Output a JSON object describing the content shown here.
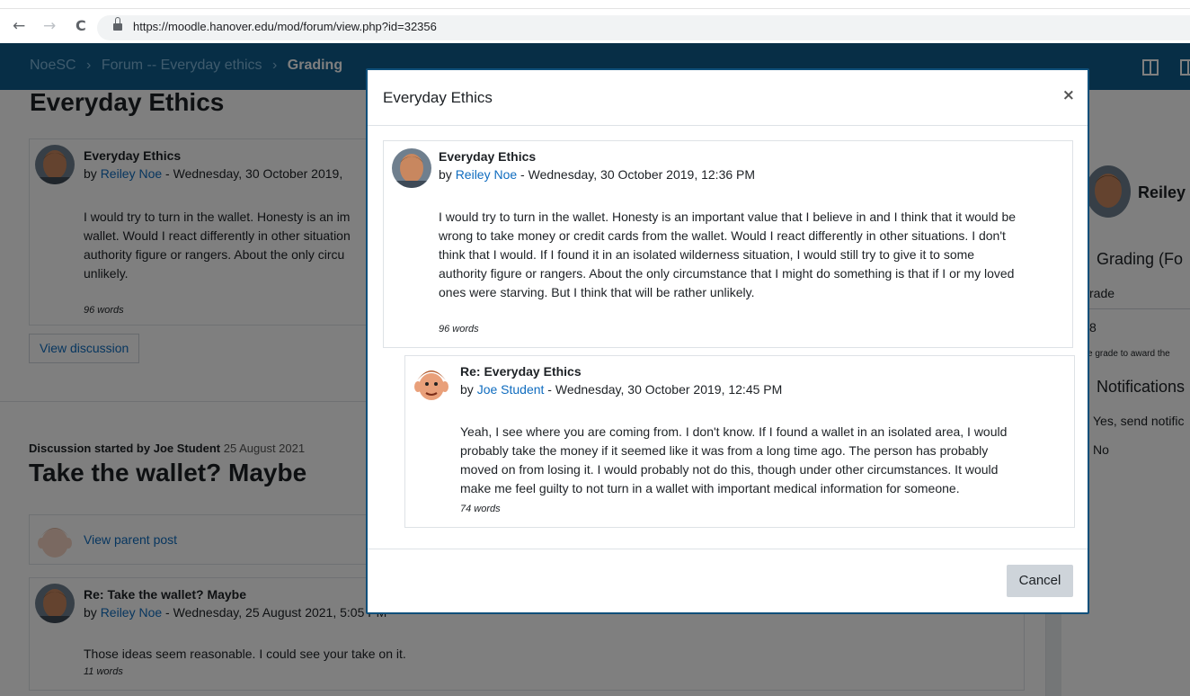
{
  "browser": {
    "back": "←",
    "forward": "→",
    "reload": "C",
    "url": "https://moodle.hanover.edu/mod/forum/view.php?id=32356"
  },
  "nav": {
    "breadcrumb": [
      "NoeSC",
      "Forum -- Everyday ethics",
      "Grading"
    ],
    "separator": "›"
  },
  "background": {
    "heading1": "Everyday Ethics",
    "post1": {
      "title": "Everyday Ethics",
      "by": "by",
      "author": "Reiley Noe",
      "date": " - Wednesday, 30 October 2019, ",
      "lines": [
        "I would try to turn in the wallet. Honesty is an im",
        "wallet. Would I react differently in other situation",
        "authority figure or rangers. About the only circu",
        "unlikely."
      ],
      "words": "96 words"
    },
    "view_discussion": "View discussion",
    "started_by_label": "Discussion started by Joe Student",
    "started_date": "25 August 2021",
    "heading2": "Take the wallet? Maybe",
    "parent_link": "View parent post",
    "post2": {
      "title": "Re: Take the wallet? Maybe",
      "by": "by",
      "author": "Reiley Noe",
      "date": " - Wednesday, 25 August 2021, 5:05 PM",
      "body": "Those ideas seem reasonable. I could see your take on it.",
      "words": "11 words"
    }
  },
  "sidebar": {
    "name": "Reiley",
    "grading": "Grading (Fo",
    "grade_label": "rade",
    "grade_value": "8",
    "grade_help": "e grade to award the",
    "notifications": "Notifications",
    "opt_yes": "Yes, send notific",
    "opt_no": "No"
  },
  "modal": {
    "title": "Everyday Ethics",
    "close": "×",
    "post": {
      "title": "Everyday Ethics",
      "by": "by",
      "author": "Reiley Noe",
      "date": " - Wednesday, 30 October 2019, 12:36 PM",
      "lines": [
        "I would try to turn in the wallet. Honesty is an important value that I believe in and I think that it would be",
        "wrong to take money or credit cards from the wallet. Would I react differently in other situations. I don't",
        "think that I would. If I found it in an isolated wilderness situation, I would still try to give it to some",
        "authority figure or rangers. About the only circumstance that I might do something is that if I or my loved",
        "ones were starving. But I think that will be rather unlikely."
      ],
      "words": "96 words"
    },
    "reply": {
      "title": "Re: Everyday Ethics",
      "by": "by",
      "author": "Joe Student",
      "date": " - Wednesday, 30 October 2019, 12:45 PM",
      "lines": [
        "Yeah, I see where you are coming from. I don't know. If I found a wallet in an isolated area, I would",
        "probably take the money if it seemed like it was from a long time ago. The person has probably",
        "moved on from losing it. I would probably not do this, though under other circumstances. It would",
        "make me feel guilty to not turn in a wallet with important medical information for someone."
      ],
      "words": "74 words"
    },
    "cancel": "Cancel"
  },
  "colors": {
    "nav": "#0f5c8c",
    "link": "#0f6cbf",
    "modal_border": "#0f4f7a"
  }
}
